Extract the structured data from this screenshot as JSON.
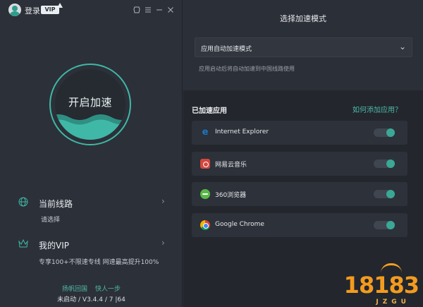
{
  "titlebar": {
    "login": "登录",
    "vip_badge": "VIP",
    "icons": [
      "skin-icon",
      "menu-icon",
      "minimize-icon",
      "close-icon"
    ]
  },
  "accelerate": {
    "button_label": "开启加速",
    "accent": "#3fb8a7"
  },
  "route": {
    "title": "当前线路",
    "subtitle": "请选择"
  },
  "vip": {
    "title": "我的VIP",
    "subtitle": "专享100+不限速专线 网速最高提升100%"
  },
  "footer": {
    "links": [
      "扬帆回国",
      "快人一步"
    ],
    "version": "未启动 / V3.4.4 / 7 |64"
  },
  "mode": {
    "title": "选择加速模式",
    "selected": "应用自动加速模式",
    "note": "应用启动后将自动加速到中国线路使用"
  },
  "apps": {
    "header": "已加速应用",
    "help_link": "如何添加应用？",
    "items": [
      {
        "name": "Internet Explorer",
        "enabled": true,
        "icon": "ie-icon"
      },
      {
        "name": "网易云音乐",
        "enabled": true,
        "icon": "netease-music-icon"
      },
      {
        "name": "360浏览器",
        "enabled": true,
        "icon": "360-browser-icon"
      },
      {
        "name": "Google Chrome",
        "enabled": true,
        "icon": "chrome-icon"
      }
    ]
  },
  "watermark": {
    "text": "18183",
    "sub": "JZGU"
  }
}
